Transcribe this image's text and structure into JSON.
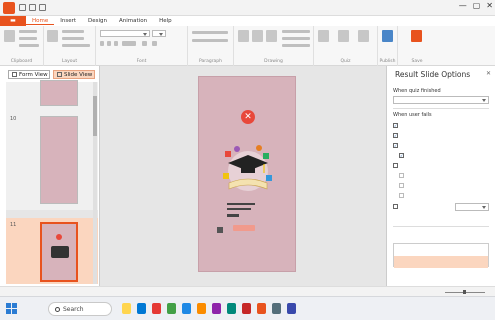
{
  "window": {
    "title": "",
    "controls": {
      "minimize": "—",
      "maximize": "▢",
      "close": "✕"
    }
  },
  "ribbon_tabs": [
    {
      "label": "Home",
      "active": true
    },
    {
      "label": "Insert"
    },
    {
      "label": "Design"
    },
    {
      "label": "Animation"
    },
    {
      "label": "Help"
    }
  ],
  "ribbon_groups": [
    "Clipboard",
    "Layout",
    "Font",
    "Paragraph",
    "Drawing",
    "Quiz",
    "Publish",
    "Save"
  ],
  "ribbon_font": {
    "name": "",
    "size": ""
  },
  "left_panel": {
    "form_view": "Form View",
    "slide_view": "Slide View",
    "slide_numbers": [
      "",
      "10",
      "11"
    ],
    "section": ""
  },
  "slide": {
    "title": ""
  },
  "right_panel": {
    "title": "Result Slide Options",
    "close": "✕",
    "when_quiz_finished": "When quiz finished",
    "when_quiz_finished_value": "",
    "when_user_fails": "When user fails",
    "options": [
      {
        "label": "",
        "checked": true
      },
      {
        "label": "",
        "checked": true
      },
      {
        "label": "",
        "checked": true
      },
      {
        "label": "",
        "checked": true
      },
      {
        "label": "",
        "checked": false
      }
    ],
    "disabled_options": [
      "",
      "",
      ""
    ],
    "retry_label": "",
    "retry_value": "",
    "list_header": "",
    "list_items": [
      "",
      ""
    ]
  },
  "statusbar": {
    "text": ""
  },
  "taskbar": {
    "search_placeholder": "Search",
    "time": "",
    "date": ""
  },
  "colors": {
    "accent": "#e8531e",
    "slide_bg": "#d7b3bb",
    "selection": "#fbd6bf"
  }
}
